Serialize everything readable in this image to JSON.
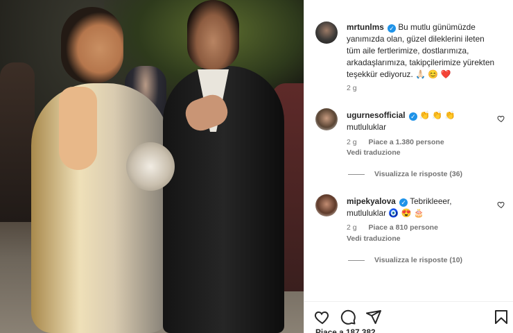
{
  "post": {
    "author": "mrtunlms",
    "caption": "Bu mutlu günümüzde yanımızda olan, güzel dileklerini ileten tüm aile fertlerimize, dostlarımıza, arkadaşlarımıza, takipçilerimize yürekten teşekkür ediyoruz.",
    "caption_emojis": "🙏🏻 😊 ❤️",
    "time": "2 g"
  },
  "comments": [
    {
      "username": "ugurnesofficial",
      "emojis": "👏 👏 👏",
      "text": "mutluluklar",
      "time": "2 g",
      "likes": "Piace a 1.380 persone",
      "translate": "Vedi traduzione",
      "replies": "Visualizza le risposte (36)"
    },
    {
      "username": "mipekyalova",
      "text_main": "Tebrikleeer,",
      "text_second": "mutluluklar",
      "emojis": "🧿 😍 🎂",
      "time": "2 g",
      "likes": "Piace a 810 persone",
      "translate": "Vedi traduzione",
      "replies": "Visualizza le risposte (10)"
    }
  ],
  "icons": [
    "like-icon",
    "comment-icon",
    "share-icon",
    "save-icon",
    "verified-badge-icon"
  ],
  "colors": {
    "verified": "#1f93e8",
    "secondary_text": "#737373",
    "text": "#262626"
  },
  "footer": {
    "likes_partial": "Piace a 187.382"
  }
}
